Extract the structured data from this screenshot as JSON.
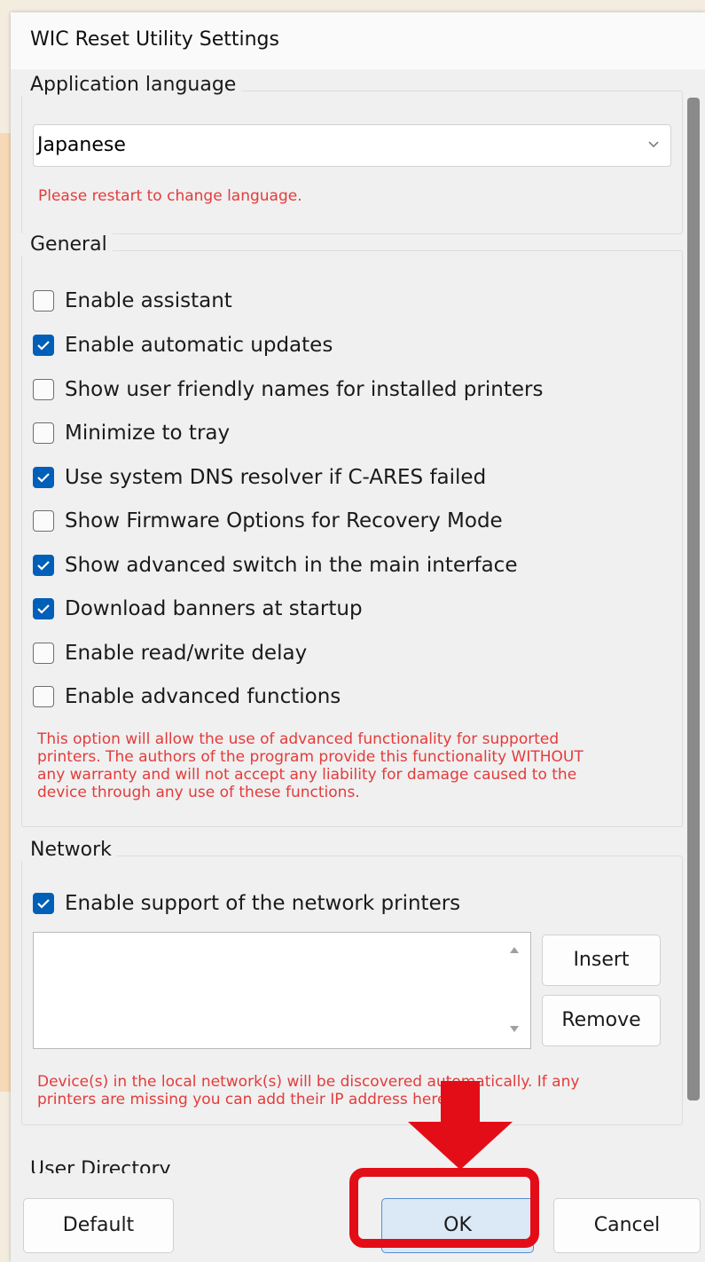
{
  "dialog": {
    "title": "WIC Reset Utility Settings"
  },
  "language_group": {
    "title": "Application language",
    "selected": "Japanese",
    "note": "Please restart to change language."
  },
  "general_group": {
    "title": "General",
    "options": [
      {
        "label": "Enable assistant",
        "checked": false
      },
      {
        "label": "Enable automatic updates",
        "checked": true
      },
      {
        "label": "Show user friendly names for installed printers",
        "checked": false
      },
      {
        "label": "Minimize to tray",
        "checked": false
      },
      {
        "label": "Use system DNS resolver if C-ARES failed",
        "checked": true
      },
      {
        "label": "Show Firmware Options for Recovery Mode",
        "checked": false
      },
      {
        "label": "Show advanced switch in the main interface",
        "checked": true
      },
      {
        "label": "Download banners at startup",
        "checked": true
      },
      {
        "label": "Enable read/write delay",
        "checked": false
      },
      {
        "label": "Enable advanced functions",
        "checked": false
      }
    ],
    "warning_lines": [
      "This option will allow the use of advanced functionality for supported",
      "printers. The authors of the program provide this functionality WITHOUT",
      "any warranty and will not accept any liability for damage caused to the",
      "device through any use of these functions."
    ]
  },
  "network_group": {
    "title": "Network",
    "enable_label": "Enable support of the network printers",
    "enable_checked": true,
    "insert_label": "Insert",
    "remove_label": "Remove",
    "note_lines": [
      "Device(s) in the local network(s) will be discovered automatically. If any",
      "printers are missing you can add their IP address here."
    ]
  },
  "user_directory_group": {
    "title": "User Directory"
  },
  "buttons": {
    "default_label": "Default",
    "ok_label": "OK",
    "cancel_label": "Cancel"
  },
  "colors": {
    "accent": "#005fb8",
    "warning": "#e43b3b",
    "annotation": "#e30d18"
  }
}
